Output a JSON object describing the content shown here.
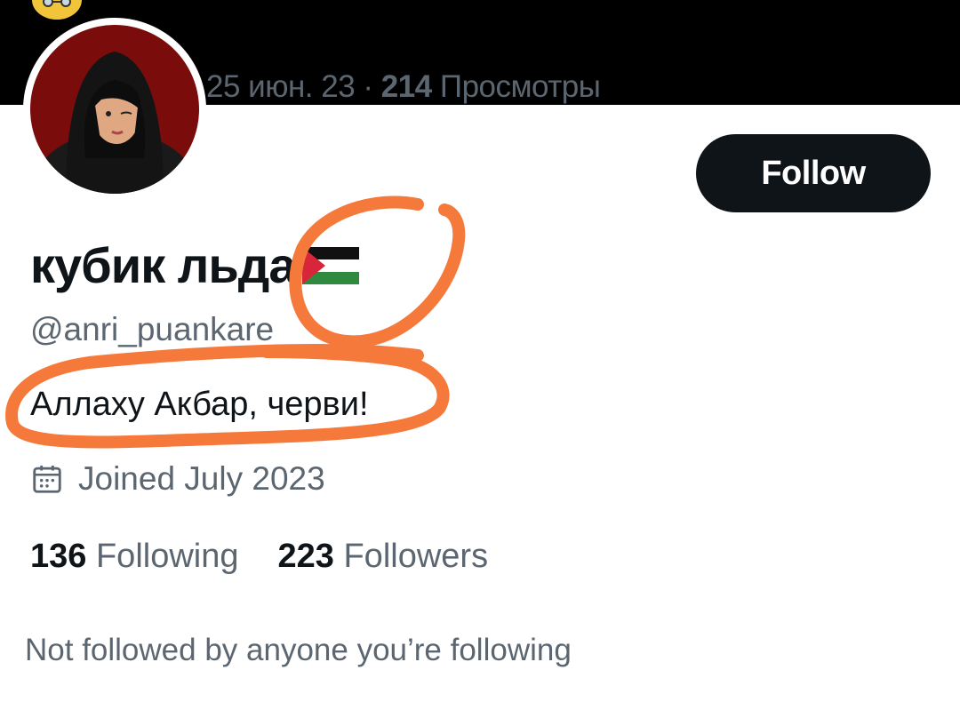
{
  "tweet_meta": {
    "date": "25 июн. 23",
    "separator": " · ",
    "views_count": "214",
    "views_label": " Просмотры"
  },
  "profile": {
    "display_name": "кубик льда",
    "handle": "@anri_puankare",
    "bio": "Аллаху Акбар, черви!",
    "joined": "Joined July 2023"
  },
  "actions": {
    "follow_label": "Follow"
  },
  "stats": {
    "following_count": "136",
    "following_label": "Following",
    "followers_count": "223",
    "followers_label": "Followers"
  },
  "footer": {
    "not_followed_text": "Not followed by anyone you’re following"
  },
  "icons": {
    "calendar": "calendar-icon",
    "flag": "palestine-flag-emoji",
    "banner_emoji": "disguised-face-emoji"
  },
  "colors": {
    "banner": "#000000",
    "follow_button": "#0f1419",
    "secondary_text": "#5b6670",
    "annotation": "#f5793a"
  }
}
